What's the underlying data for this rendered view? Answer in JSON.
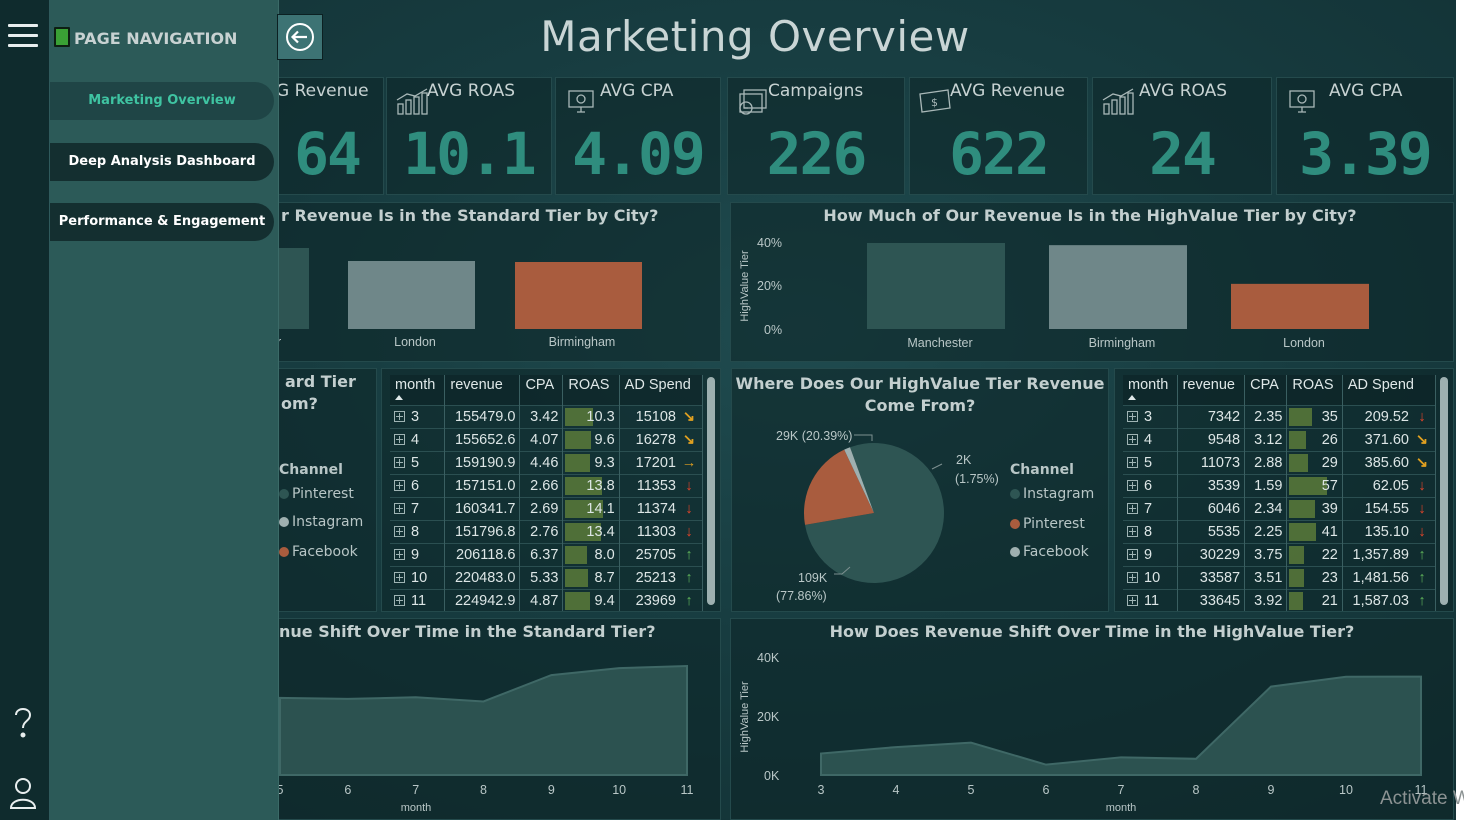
{
  "page_title": "Marketing Overview",
  "nav": {
    "header": "PAGE NAVIGATION",
    "items": [
      {
        "label": "Marketing Overview",
        "active": true
      },
      {
        "label": "Deep Analysis Dashboard",
        "active": false
      },
      {
        "label": "Performance & Engagement",
        "active": false
      }
    ]
  },
  "kpis_left": [
    {
      "label": "G Revenue",
      "value": "64"
    },
    {
      "label": "AVG ROAS",
      "value": "10.1"
    },
    {
      "label": "AVG CPA",
      "value": "4.09"
    }
  ],
  "kpis_right": [
    {
      "label": "Campaigns",
      "value": "226"
    },
    {
      "label": "AVG Revenue",
      "value": "622"
    },
    {
      "label": "AVG ROAS",
      "value": "24"
    },
    {
      "label": "AVG CPA",
      "value": "3.39"
    }
  ],
  "bar_left": {
    "title": "r Revenue Is in the Standard Tier by City?",
    "labels": [
      "r",
      "London",
      "Birmingham"
    ]
  },
  "bar_right": {
    "title": "How Much of Our Revenue Is in the HighValue Tier by City?",
    "ylabel": "HighValue Tier",
    "yticks": [
      "40%",
      "20%",
      "0%"
    ],
    "labels": [
      "Manchester",
      "Birmingham",
      "London"
    ]
  },
  "pie_left": {
    "title_line1": "ard Tier",
    "title_line2": "om?",
    "legend_title": "Channel",
    "legend": [
      "Pinterest",
      "Instagram",
      "Facebook"
    ]
  },
  "pie_right": {
    "title_line1": "Where Does Our HighValue Tier Revenue",
    "title_line2": "Come From?",
    "legend_title": "Channel",
    "legend": [
      "Instagram",
      "Pinterest",
      "Facebook"
    ],
    "label_pinterest": "29K (20.39%)",
    "label_facebook_1": "2K",
    "label_facebook_2": "(1.75%)",
    "label_instagram_1": "109K",
    "label_instagram_2": "(77.86%)"
  },
  "table_left": {
    "headers": [
      "month",
      "revenue",
      "CPA",
      "ROAS",
      "AD Spend"
    ],
    "rows": [
      [
        "3",
        "155479.0",
        "3.42",
        "10.3",
        "15108"
      ],
      [
        "4",
        "155652.6",
        "4.07",
        "9.6",
        "16278"
      ],
      [
        "5",
        "159190.9",
        "4.46",
        "9.3",
        "17201"
      ],
      [
        "6",
        "157151.0",
        "2.66",
        "13.8",
        "11353"
      ],
      [
        "7",
        "160341.7",
        "2.69",
        "14.1",
        "11374"
      ],
      [
        "8",
        "151796.8",
        "2.76",
        "13.4",
        "11303"
      ],
      [
        "9",
        "206118.6",
        "6.37",
        "8.0",
        "25705"
      ],
      [
        "10",
        "220483.0",
        "5.33",
        "8.7",
        "25213"
      ],
      [
        "11",
        "224942.9",
        "4.87",
        "9.4",
        "23969"
      ]
    ]
  },
  "table_right": {
    "headers": [
      "month",
      "revenue",
      "CPA",
      "ROAS",
      "AD Spend"
    ],
    "rows": [
      [
        "3",
        "7342",
        "2.35",
        "35",
        "209.52"
      ],
      [
        "4",
        "9548",
        "3.12",
        "26",
        "371.60"
      ],
      [
        "5",
        "11073",
        "2.88",
        "29",
        "385.60"
      ],
      [
        "6",
        "3539",
        "1.59",
        "57",
        "62.05"
      ],
      [
        "7",
        "6046",
        "2.34",
        "39",
        "154.55"
      ],
      [
        "8",
        "5535",
        "2.25",
        "41",
        "135.10"
      ],
      [
        "9",
        "30229",
        "3.75",
        "22",
        "1,357.89"
      ],
      [
        "10",
        "33587",
        "3.51",
        "23",
        "1,481.56"
      ],
      [
        "11",
        "33645",
        "3.92",
        "21",
        "1,587.03"
      ]
    ]
  },
  "area_left": {
    "title": "nue Shift Over Time in the Standard Tier?",
    "xlabel": "month",
    "xticks": [
      "5",
      "6",
      "7",
      "8",
      "9",
      "10",
      "11"
    ]
  },
  "area_right": {
    "title": "How Does Revenue Shift Over Time in the HighValue Tier?",
    "xlabel": "month",
    "ylabel": "HighValue Tier",
    "yticks": [
      "40K",
      "20K",
      "0K"
    ],
    "xticks": [
      "3",
      "4",
      "5",
      "6",
      "7",
      "8",
      "9",
      "10",
      "11"
    ]
  },
  "colors": {
    "kpi_value": "#2f8d7e",
    "bar_dark": "#2e5553",
    "bar_grey": "#6f8789",
    "bar_orange": "#a95c3e",
    "area_fill": "#2c5250",
    "arrow_down": "#e0442a",
    "arrow_diag": "#e0a020",
    "arrow_up": "#5fb25a"
  },
  "chart_data": [
    {
      "type": "bar",
      "title": "How Much of Our Revenue Is in the HighValue Tier by City?",
      "ylabel": "HighValue Tier",
      "categories": [
        "Manchester",
        "Birmingham",
        "London"
      ],
      "values": [
        0.4,
        0.39,
        0.21
      ],
      "ylim": [
        0,
        0.4
      ]
    },
    {
      "type": "bar",
      "categories": [
        "London",
        "Birmingham"
      ],
      "values": [
        0.34,
        0.33
      ]
    },
    {
      "type": "pie",
      "title": "Where Does Our HighValue Tier Revenue Come From?",
      "categories": [
        "Instagram",
        "Pinterest",
        "Facebook"
      ],
      "values": [
        109,
        29,
        2
      ],
      "percent": [
        77.86,
        20.39,
        1.75
      ]
    },
    {
      "type": "area",
      "title": "How Does Revenue Shift Over Time in the HighValue Tier?",
      "xlabel": "month",
      "ylabel": "HighValue Tier",
      "x": [
        3,
        4,
        5,
        6,
        7,
        8,
        9,
        10,
        11
      ],
      "values": [
        7342,
        9548,
        11073,
        3539,
        6046,
        5535,
        30229,
        33587,
        33645
      ],
      "ylim": [
        0,
        40000
      ]
    },
    {
      "type": "area",
      "xlabel": "month",
      "x": [
        5,
        6,
        7,
        8,
        9,
        10,
        11
      ],
      "values": [
        159190.9,
        157151.0,
        160341.7,
        151796.8,
        206118.6,
        220483.0,
        224942.9
      ]
    }
  ]
}
